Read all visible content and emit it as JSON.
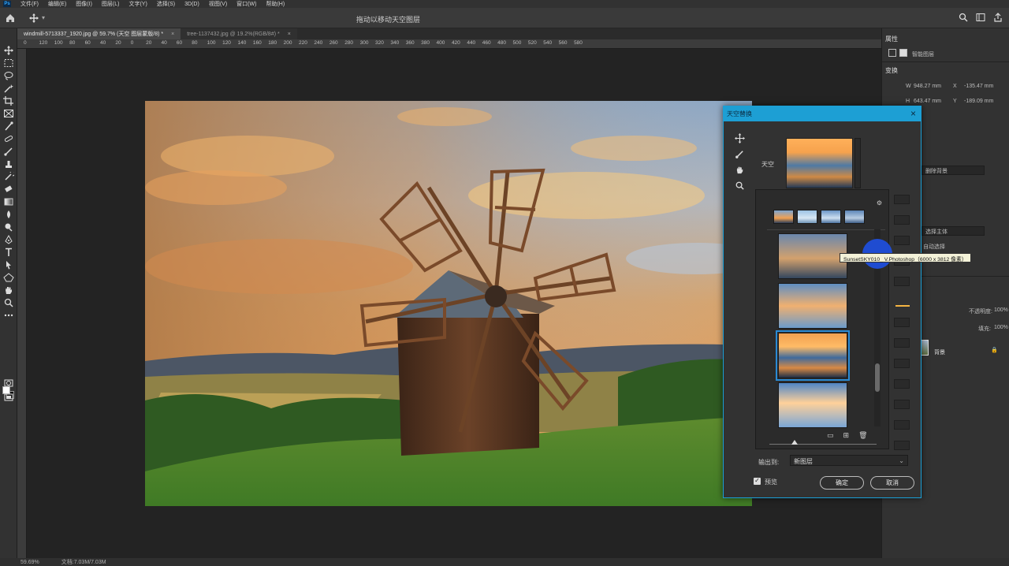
{
  "menubar": {
    "items": [
      "文件(F)",
      "编辑(E)",
      "图像(I)",
      "图层(L)",
      "文字(Y)",
      "选择(S)",
      "3D(D)",
      "视图(V)",
      "窗口(W)",
      "帮助(H)"
    ]
  },
  "optionsbar": {
    "title": "拖动以移动天空图层",
    "right_icons": [
      "search-icon",
      "workspace-icon",
      "share-icon"
    ]
  },
  "tabs": [
    {
      "label": "windmill-5713337_1920.jpg @ 59.7% (天空 图层蒙版/8) *",
      "active": true
    },
    {
      "label": "tree-1137432.jpg @ 19.2%(RGB/8#) *",
      "active": false
    }
  ],
  "ruler": {
    "top_numbers": [
      "0",
      "120",
      "100",
      "80",
      "60",
      "40",
      "20",
      "0",
      "20",
      "40",
      "60",
      "80",
      "100",
      "120",
      "140",
      "160",
      "180",
      "200",
      "220",
      "240",
      "260",
      "280",
      "300",
      "320",
      "340",
      "360",
      "380",
      "400",
      "420",
      "440",
      "460",
      "480",
      "500",
      "520",
      "540",
      "560",
      "580"
    ]
  },
  "status": {
    "zoom": "59.69%",
    "doc": "文档:7.03M/7.03M"
  },
  "properties": {
    "title": "属性",
    "smart_label": "智能图层",
    "transform_label": "变换",
    "w": "948.27 mm",
    "x": "-135.47 mm",
    "h": "643.47 mm",
    "y": "-189.09 mm",
    "sky_fn1": "删除背景",
    "sky_fn2": "选择主体",
    "sky_fn3": "自动选择"
  },
  "layers": {
    "opacity_label": "不透明度:",
    "opacity_value": "100%",
    "fill_label": "填充:",
    "fill_value": "100%",
    "layer_name": "背景"
  },
  "dialog": {
    "title": "天空替换",
    "sky_label": "天空",
    "output_label": "输出到:",
    "output_value": "新图层",
    "preview_label": "预览",
    "ok_label": "确定",
    "cancel_label": "取消"
  },
  "tooltip": "SunsetSKY010_ V.Photoshop（6000 x 3812 像素）"
}
